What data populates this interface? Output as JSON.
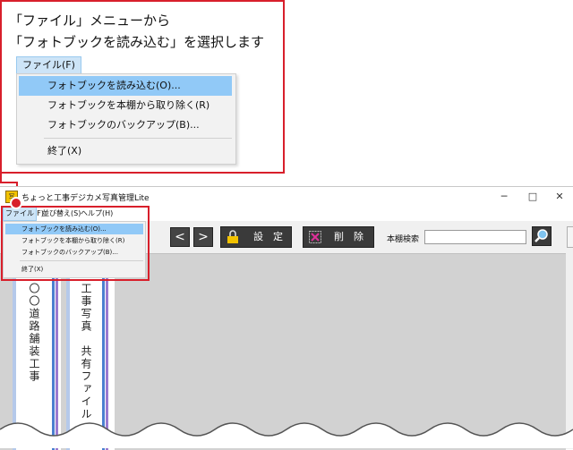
{
  "callout": {
    "line1": "「ファイル」メニューから",
    "line2": "「フォトブックを読み込む」を選択します",
    "menu_label": "ファイル(F)",
    "items": [
      "フォトブックを読み込む(O)...",
      "フォトブックを本棚から取り除く(R)",
      "フォトブックのバックアップ(B)...",
      "終了(X)"
    ]
  },
  "window": {
    "title": "ちょっと工事デジカメ写真管理Lite",
    "controls": {
      "minimize": "─",
      "maximize": "□",
      "close": "✕"
    },
    "menu": {
      "file": "ファイル(F)",
      "sort": "並び替え(S)",
      "help": "ヘルプ(H)"
    },
    "file_menu_items": [
      "フォトブックを読み込む(O)...",
      "フォトブックを本棚から取り除く(R)",
      "フォトブックのバックアップ(B)...",
      "終了(X)"
    ],
    "toolbar": {
      "prev": "<",
      "next": ">",
      "settings": "設　定",
      "delete": "削　除",
      "search_label": "本棚検索",
      "search_value": ""
    },
    "books": [
      {
        "title": "〇〇道路舗装工事"
      },
      {
        "title": "工事写真　共有ファイル"
      }
    ]
  },
  "colors": {
    "callout_border": "#d81f2b",
    "highlight": "#91c9f7",
    "book_stripe_blue": "#4a7fd0",
    "book_stripe_purple": "#9a7ad0"
  },
  "icons": [
    "app-icon",
    "lock-icon",
    "delete-x-icon",
    "magnifier-icon"
  ]
}
